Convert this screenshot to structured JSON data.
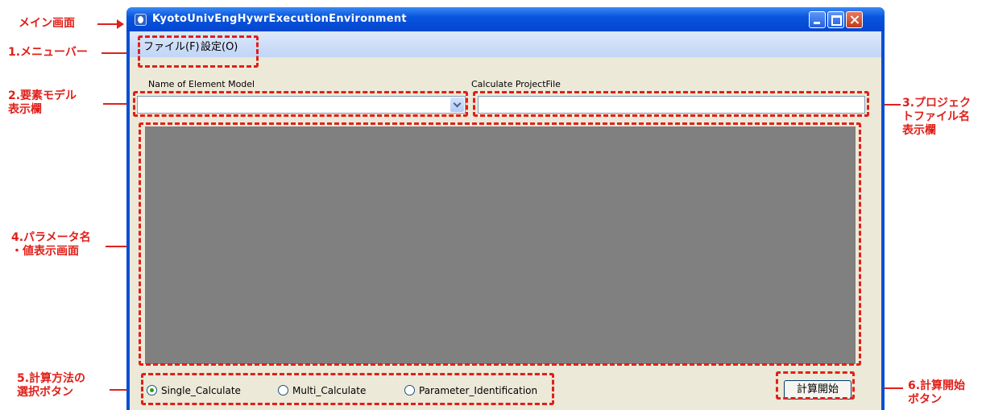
{
  "window": {
    "title": "KyotoUnivEngHywrExecutionEnvironment"
  },
  "menu": {
    "items": [
      {
        "label": "ファイル(F)"
      },
      {
        "label": "設定(O)"
      }
    ]
  },
  "fields": {
    "element_model_label": "Name of Element Model",
    "element_model_value": "",
    "project_file_label": "Calculate ProjectFile",
    "project_file_value": ""
  },
  "radios": [
    {
      "label": "Single_Calculate",
      "selected": true
    },
    {
      "label": "Multi_Calculate",
      "selected": false
    },
    {
      "label": "Parameter_Identification",
      "selected": false
    }
  ],
  "start_button": {
    "label": "計算開始"
  },
  "annotations": {
    "main_screen": "メイン画面",
    "menubar": "1.メニューバー",
    "element_model_line1": "2.要素モデル",
    "element_model_line2": "表示欄",
    "project_file_line1": "3.プロジェク",
    "project_file_line2": "トファイル名",
    "project_file_line3": "表示欄",
    "param_line1": "4.パラメータ名",
    "param_line2": "・値表示画面",
    "calc_method_line1": "5.計算方法の",
    "calc_method_line2": "選択ボタン",
    "start_line1": "6.計算開始",
    "start_line2": "ボタン"
  },
  "colors": {
    "annotation": "#e0201a",
    "titlebar": "#0a4fd4",
    "panel": "#808080",
    "client": "#ece9d8"
  }
}
